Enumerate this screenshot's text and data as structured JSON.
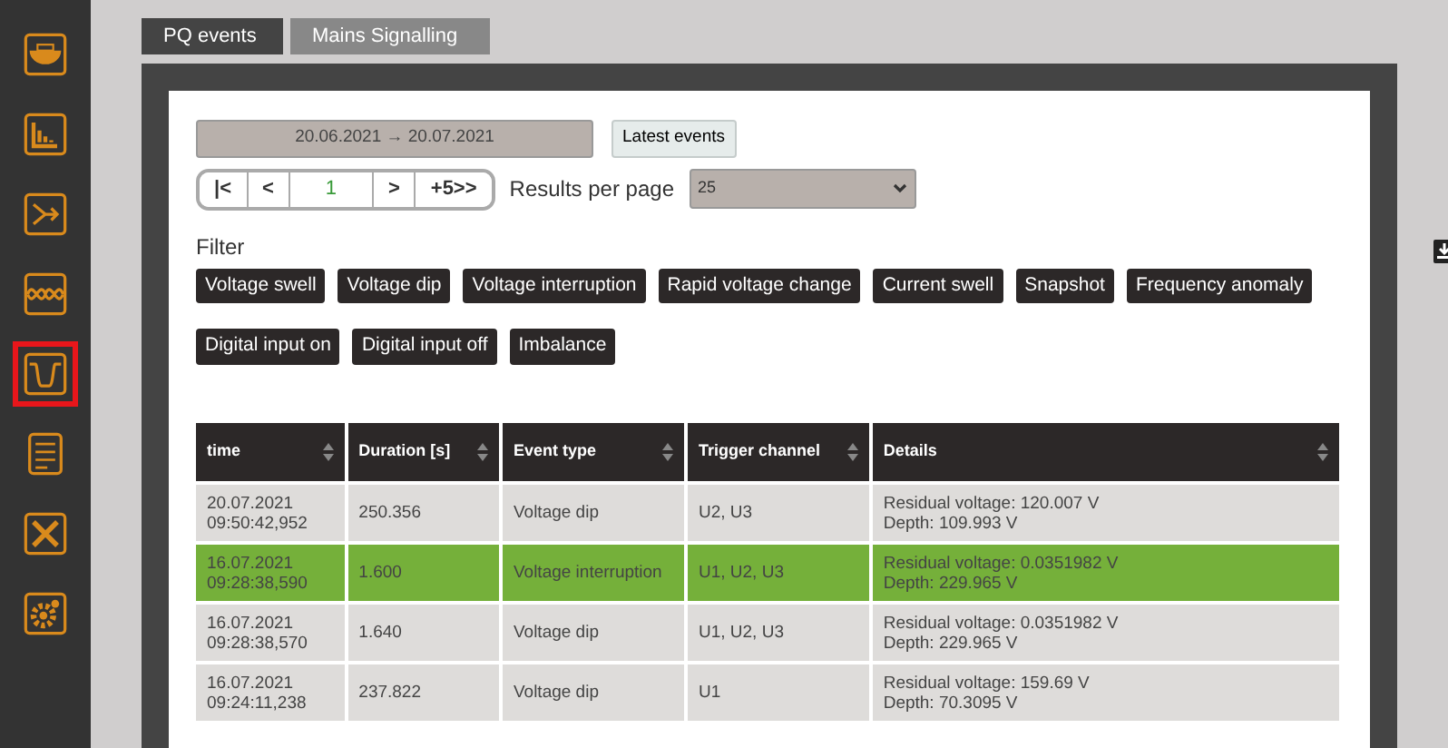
{
  "sidebar": {
    "items": [
      {
        "selected": false
      },
      {
        "selected": false
      },
      {
        "selected": false
      },
      {
        "selected": false
      },
      {
        "selected": true
      },
      {
        "selected": false
      },
      {
        "selected": false
      },
      {
        "selected": false
      }
    ]
  },
  "tabs": [
    {
      "label": "PQ events",
      "selected": true
    },
    {
      "label": "Mains Signalling",
      "selected": false
    }
  ],
  "date_range": "20.06.2021 → 20.07.2021",
  "latest_events_button": "Latest events",
  "pagination": {
    "buttons": [
      {
        "label": "|<",
        "selected": false
      },
      {
        "label": "<",
        "selected": false
      },
      {
        "label": "1",
        "selected": true
      },
      {
        "label": ">",
        "selected": false
      },
      {
        "label": "+5>>",
        "selected": false
      }
    ],
    "results_label": "Results per page",
    "results_value": "25"
  },
  "filter": {
    "label": "Filter",
    "chips": [
      "Voltage swell",
      "Voltage dip",
      "Voltage interruption",
      "Rapid voltage change",
      "Current swell",
      "Snapshot",
      "Frequency anomaly",
      "Digital input on",
      "Digital input off",
      "Imbalance"
    ]
  },
  "table": {
    "columns": [
      "time",
      "Duration [s]",
      "Event type",
      "Trigger channel",
      "Details"
    ],
    "rows": [
      {
        "selected": false,
        "cells": [
          [
            "20.07.2021",
            "09:50:42,952"
          ],
          [
            "250.356"
          ],
          [
            "Voltage dip"
          ],
          [
            "U2, U3"
          ],
          [
            "Residual voltage: 120.007 V",
            "Depth: 109.993 V"
          ]
        ]
      },
      {
        "selected": true,
        "cells": [
          [
            "16.07.2021",
            "09:28:38,590"
          ],
          [
            "1.600"
          ],
          [
            "Voltage interruption"
          ],
          [
            "U1, U2, U3"
          ],
          [
            "Residual voltage: 0.0351982 V",
            "Depth: 229.965 V"
          ]
        ]
      },
      {
        "selected": false,
        "cells": [
          [
            "16.07.2021",
            "09:28:38,570"
          ],
          [
            "1.640"
          ],
          [
            "Voltage dip"
          ],
          [
            "U1, U2, U3"
          ],
          [
            "Residual voltage: 0.0351982 V",
            "Depth: 229.965 V"
          ]
        ]
      },
      {
        "selected": false,
        "cells": [
          [
            "16.07.2021",
            "09:24:11,238"
          ],
          [
            "237.822"
          ],
          [
            "Voltage dip"
          ],
          [
            "U1"
          ],
          [
            "Residual voltage: 159.69 V",
            "Depth: 70.3095 V"
          ]
        ]
      }
    ]
  }
}
